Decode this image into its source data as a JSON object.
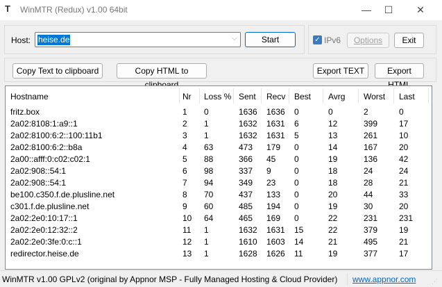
{
  "window": {
    "title": "WinMTR (Redux) v1.00 64bit",
    "minimize": "—",
    "maximize": "☐",
    "close": "✕"
  },
  "host": {
    "label": "Host:",
    "value": "heise.de",
    "start": "Start"
  },
  "options": {
    "ipv6_label": "IPv6",
    "ipv6_checked": true,
    "options_label": "Options",
    "exit_label": "Exit"
  },
  "actions": {
    "copy_text": "Copy Text to clipboard",
    "copy_html": "Copy HTML to clipboard",
    "export_text": "Export TEXT",
    "export_html": "Export HTML"
  },
  "columns": [
    "Hostname",
    "Nr",
    "Loss %",
    "Sent",
    "Recv",
    "Best",
    "Avrg",
    "Worst",
    "Last"
  ],
  "rows": [
    [
      "fritz.box",
      "1",
      "0",
      "1636",
      "1636",
      "0",
      "0",
      "2",
      "0"
    ],
    [
      "2a02:8108:1:a9::1",
      "2",
      "1",
      "1632",
      "1631",
      "6",
      "12",
      "399",
      "17"
    ],
    [
      "2a02:8100:6:2::100:11b1",
      "3",
      "1",
      "1632",
      "1631",
      "5",
      "13",
      "261",
      "10"
    ],
    [
      "2a02:8100:6:2::b8a",
      "4",
      "63",
      "473",
      "179",
      "0",
      "14",
      "167",
      "20"
    ],
    [
      "2a00::afff:0:c02:c02:1",
      "5",
      "88",
      "366",
      "45",
      "0",
      "19",
      "136",
      "42"
    ],
    [
      "2a02:908::54:1",
      "6",
      "98",
      "337",
      "9",
      "0",
      "18",
      "24",
      "24"
    ],
    [
      "2a02:908::54:1",
      "7",
      "94",
      "349",
      "23",
      "0",
      "18",
      "28",
      "21"
    ],
    [
      "be100.c350.f.de.plusline.net",
      "8",
      "70",
      "437",
      "133",
      "0",
      "20",
      "44",
      "33"
    ],
    [
      "c301.f.de.plusline.net",
      "9",
      "60",
      "485",
      "194",
      "0",
      "19",
      "30",
      "20"
    ],
    [
      "2a02:2e0:10:17::1",
      "10",
      "64",
      "465",
      "169",
      "0",
      "22",
      "231",
      "231"
    ],
    [
      "2a02:2e0:12:32::2",
      "11",
      "1",
      "1632",
      "1631",
      "15",
      "22",
      "379",
      "19"
    ],
    [
      "2a02:2e0:3fe:0:c::1",
      "12",
      "1",
      "1610",
      "1603",
      "14",
      "21",
      "495",
      "21"
    ],
    [
      "redirector.heise.de",
      "13",
      "1",
      "1628",
      "1626",
      "11",
      "19",
      "377",
      "17"
    ]
  ],
  "status": {
    "text": "WinMTR v1.00 GPLv2 (original by Appnor MSP - Fully Managed Hosting & Cloud Provider)",
    "link": "www.appnor.com"
  }
}
